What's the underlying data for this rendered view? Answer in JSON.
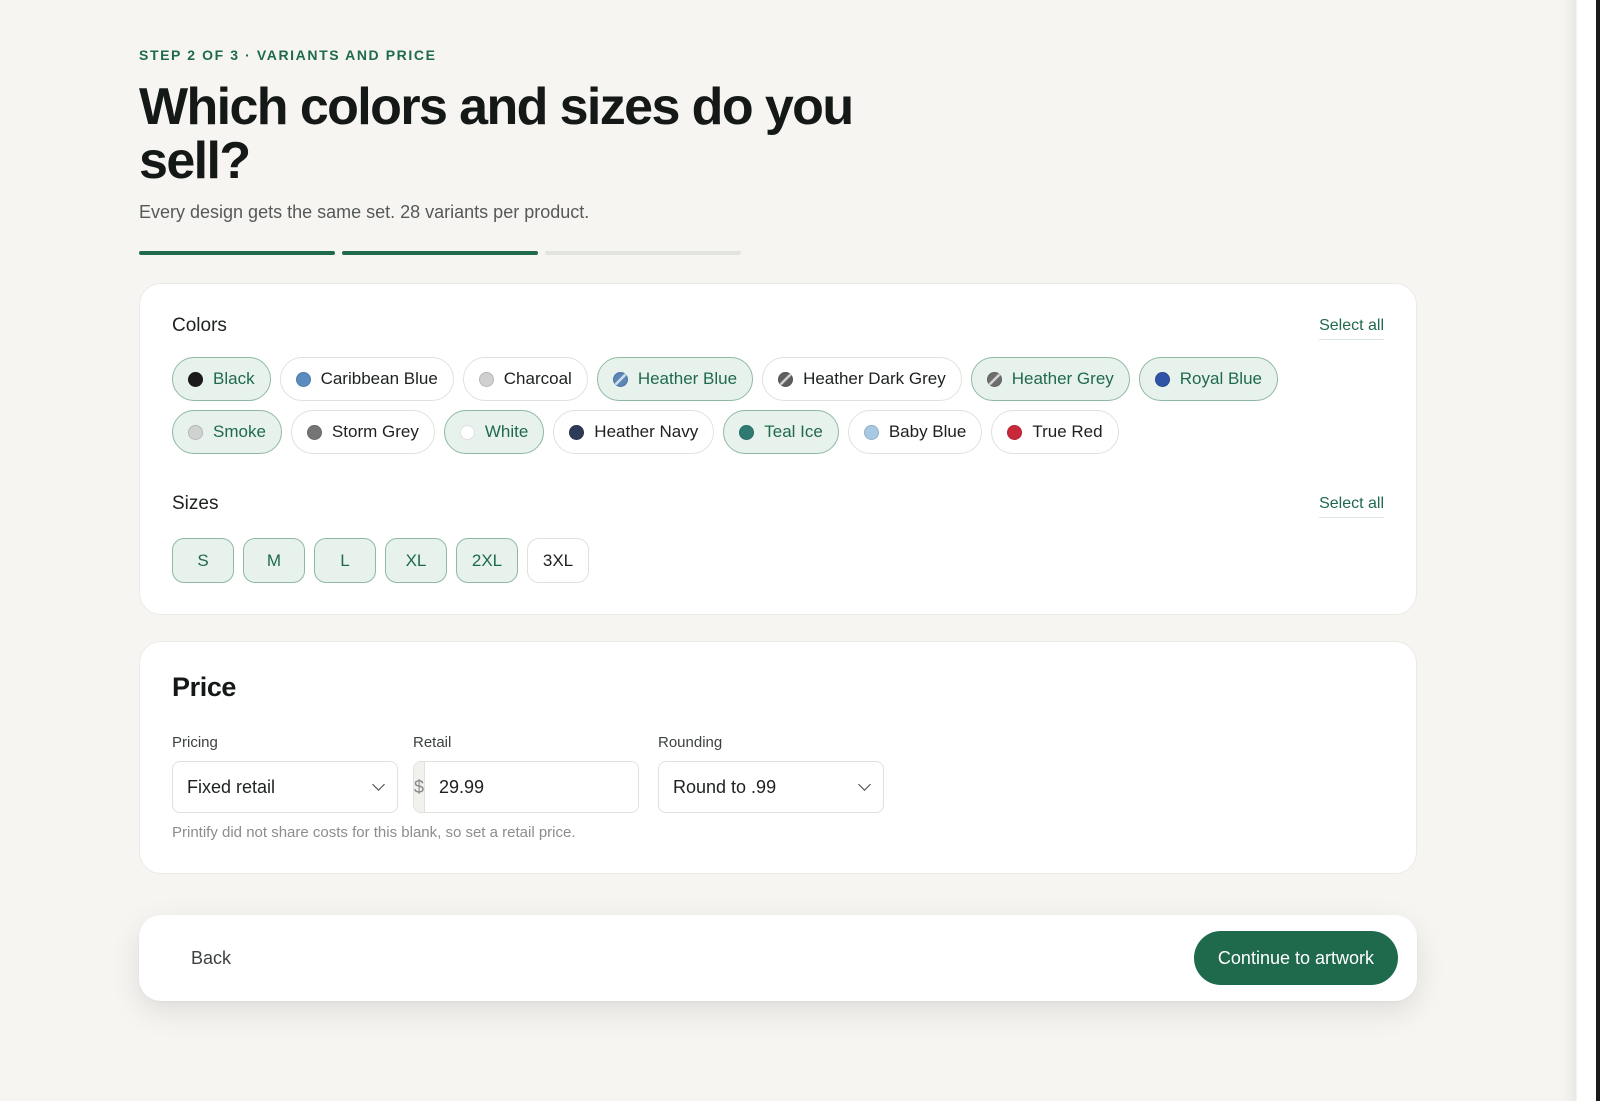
{
  "header": {
    "step_label": "STEP 2 OF 3 · VARIANTS AND PRICE",
    "title": "Which colors and sizes do you sell?",
    "subtitle": "Every design gets the same set. 28 variants per product.",
    "progress": {
      "current_step": 2,
      "total_steps": 3
    }
  },
  "variants": {
    "colors_title": "Colors",
    "colors_select_all": "Select all",
    "colors": [
      {
        "label": "Black",
        "swatch": "#1b1b1b",
        "selected": true,
        "heather": false
      },
      {
        "label": "Caribbean Blue",
        "swatch": "#5a8cbf",
        "selected": false,
        "heather": false
      },
      {
        "label": "Charcoal",
        "swatch": "#cfd0cf",
        "selected": false,
        "heather": false
      },
      {
        "label": "Heather Blue",
        "swatch": "#5c86b8",
        "selected": true,
        "heather": true
      },
      {
        "label": "Heather Dark Grey",
        "swatch": "#5e5e5e",
        "selected": false,
        "heather": true
      },
      {
        "label": "Heather Grey",
        "swatch": "#6d6d6d",
        "selected": true,
        "heather": true
      },
      {
        "label": "Royal Blue",
        "swatch": "#2f53a6",
        "selected": true,
        "heather": false
      },
      {
        "label": "Smoke",
        "swatch": "#cfd2d0",
        "selected": true,
        "heather": false
      },
      {
        "label": "Storm Grey",
        "swatch": "#757575",
        "selected": false,
        "heather": false
      },
      {
        "label": "White",
        "swatch": "#ffffff",
        "selected": true,
        "heather": false
      },
      {
        "label": "Heather Navy",
        "swatch": "#2d3a58",
        "selected": false,
        "heather": false
      },
      {
        "label": "Teal Ice",
        "swatch": "#2f7a73",
        "selected": true,
        "heather": false
      },
      {
        "label": "Baby Blue",
        "swatch": "#a7c9e4",
        "selected": false,
        "heather": false
      },
      {
        "label": "True Red",
        "swatch": "#c8283a",
        "selected": false,
        "heather": false
      }
    ],
    "sizes_title": "Sizes",
    "sizes_select_all": "Select all",
    "sizes": [
      {
        "label": "S",
        "selected": true
      },
      {
        "label": "M",
        "selected": true
      },
      {
        "label": "L",
        "selected": true
      },
      {
        "label": "XL",
        "selected": true
      },
      {
        "label": "2XL",
        "selected": true
      },
      {
        "label": "3XL",
        "selected": false
      }
    ]
  },
  "price": {
    "title": "Price",
    "pricing_label": "Pricing",
    "pricing_value": "Fixed retail",
    "retail_label": "Retail",
    "retail_prefix": "$",
    "retail_value": "29.99",
    "rounding_label": "Rounding",
    "rounding_value": "Round to .99",
    "hint": "Printify did not share costs for this blank, so set a retail price."
  },
  "footer": {
    "back_label": "Back",
    "continue_label": "Continue to artwork"
  },
  "colors": {
    "accent": "#1f6a4c",
    "selected_bg": "#e8f2ec",
    "background": "#f6f5f2"
  }
}
